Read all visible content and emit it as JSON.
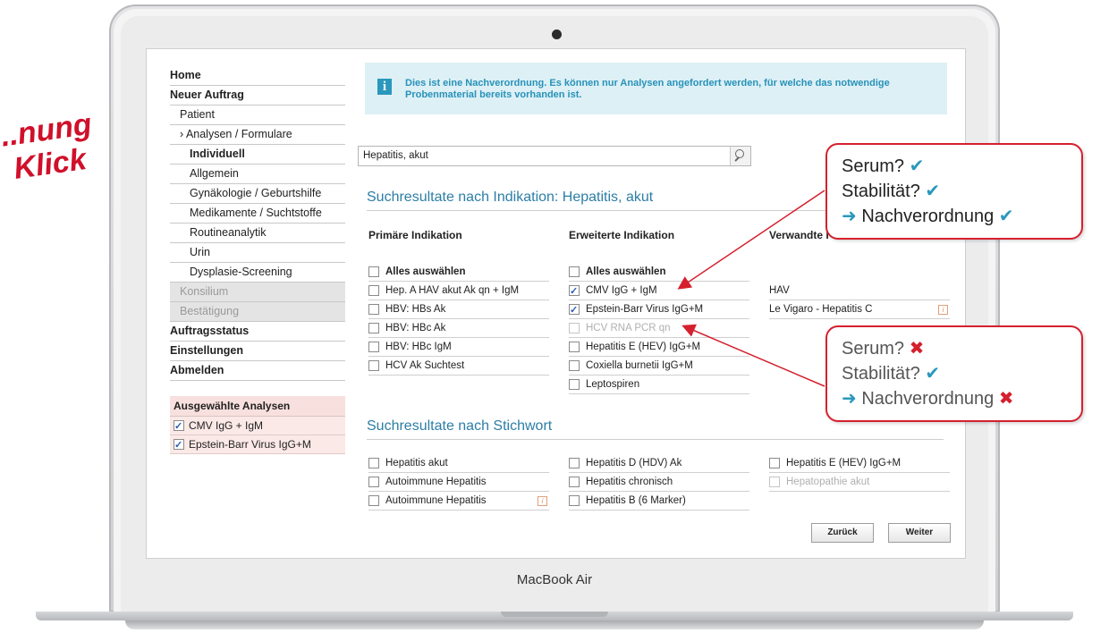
{
  "promo": {
    "line1": "...nung",
    "line2": "Klick"
  },
  "device": {
    "brand": "MacBook Air"
  },
  "nav": {
    "items": [
      {
        "label": "Home",
        "style": "bold"
      },
      {
        "label": "Neuer Auftrag",
        "style": "bold"
      },
      {
        "label": "Patient",
        "style": "l1"
      },
      {
        "label": "› Analysen / Formulare",
        "style": "l1"
      },
      {
        "label": "Individuell",
        "style": "l2 bold"
      },
      {
        "label": "Allgemein",
        "style": "l2"
      },
      {
        "label": "Gynäkologie / Geburtshilfe",
        "style": "l2"
      },
      {
        "label": "Medikamente / Suchtstoffe",
        "style": "l2"
      },
      {
        "label": "Routineanalytik",
        "style": "l2"
      },
      {
        "label": "Urin",
        "style": "l2"
      },
      {
        "label": "Dysplasie-Screening",
        "style": "l2"
      },
      {
        "label": "Konsilium",
        "style": "grey"
      },
      {
        "label": "Bestätigung",
        "style": "grey"
      },
      {
        "label": "Auftragsstatus",
        "style": "bold"
      },
      {
        "label": "Einstellungen",
        "style": "bold"
      },
      {
        "label": "Abmelden",
        "style": "bold"
      }
    ]
  },
  "selected": {
    "title": "Ausgewählte Analysen",
    "items": [
      "CMV IgG + IgM",
      "Epstein-Barr Virus IgG+M"
    ]
  },
  "info": {
    "text": "Dies ist eine Nachverordnung. Es können nur Analysen angefordert werden, für welche das notwendige Probenmaterial bereits vorhanden ist."
  },
  "search": {
    "value": "Hepatitis, akut"
  },
  "indication": {
    "title": "Suchresultate nach Indikation: Hepatitis, akut",
    "col1": {
      "header": "Primäre Indikation",
      "select_all": "Alles auswählen",
      "items": [
        {
          "label": "Hep. A HAV akut Ak qn + IgM",
          "checked": false,
          "disabled": false
        },
        {
          "label": "HBV: HBs Ak",
          "checked": false,
          "disabled": false
        },
        {
          "label": "HBV: HBc Ak",
          "checked": false,
          "disabled": false
        },
        {
          "label": "HBV: HBc IgM",
          "checked": false,
          "disabled": false
        },
        {
          "label": "HCV Ak Suchtest",
          "checked": false,
          "disabled": false
        }
      ]
    },
    "col2": {
      "header": "Erweiterte Indikation",
      "select_all": "Alles auswählen",
      "items": [
        {
          "label": "CMV IgG + IgM",
          "checked": true,
          "disabled": false
        },
        {
          "label": "Epstein-Barr Virus IgG+M",
          "checked": true,
          "disabled": false
        },
        {
          "label": "HCV RNA PCR qn",
          "checked": false,
          "disabled": true
        },
        {
          "label": "Hepatitis E (HEV) IgG+M",
          "checked": false,
          "disabled": false
        },
        {
          "label": "Coxiella burnetii IgG+M",
          "checked": false,
          "disabled": false
        },
        {
          "label": "Leptospiren",
          "checked": false,
          "disabled": false
        }
      ]
    },
    "col3": {
      "header": "Verwandte I",
      "items": [
        {
          "label": "HAV"
        },
        {
          "label": "Le Vigaro - Hepatitis C"
        }
      ]
    }
  },
  "keyword": {
    "title": "Suchresultate nach Stichwort",
    "col1": [
      {
        "label": "Hepatitis akut",
        "disabled": false,
        "info": false
      },
      {
        "label": "Autoimmune Hepatitis",
        "disabled": false,
        "info": false
      },
      {
        "label": "Autoimmune Hepatitis",
        "disabled": false,
        "info": true
      }
    ],
    "col2": [
      {
        "label": "Hepatitis D (HDV) Ak",
        "disabled": false
      },
      {
        "label": "Hepatitis chronisch",
        "disabled": false
      },
      {
        "label": "Hepatitis B (6 Marker)",
        "disabled": false
      }
    ],
    "col3": [
      {
        "label": "Hepatitis E (HEV) IgG+M",
        "disabled": false
      },
      {
        "label": "Hepatopathie akut",
        "disabled": true
      }
    ]
  },
  "buttons": {
    "back": "Zurück",
    "next": "Weiter"
  },
  "callout1": {
    "line1": "Serum?",
    "line2": "Stabilität?",
    "line3": "Nachverordnung"
  },
  "callout2": {
    "line1": "Serum?",
    "line2": "Stabilität?",
    "line3": "Nachverordnung"
  },
  "colors": {
    "accent": "#2c7ea6",
    "alert": "#d5202e",
    "info_bg": "#ddf0f6",
    "selected_bg": "#fbe9e7"
  }
}
